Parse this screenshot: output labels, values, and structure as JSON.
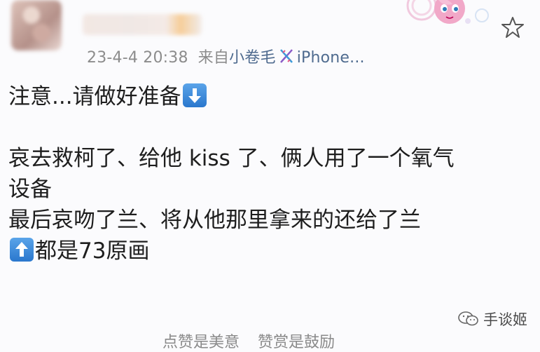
{
  "post": {
    "timestamp": "23-4-4 20:38",
    "source_prefix": "来自",
    "source_name": "小卷毛",
    "source_device": "iPhone...",
    "lines": [
      "注意...请做好准备",
      "哀去救柯了、给他 kiss 了、俩人用了一个氧气",
      "设备",
      "最后哀吻了兰、将从他那里拿来的还给了兰",
      "都是73原画"
    ]
  },
  "footer": {
    "like_text": "点赞是美意",
    "reward_text": "赞赏是鼓励"
  },
  "watermark": {
    "text": "手谈姬"
  },
  "icons": {
    "star": "star-icon",
    "dna": "dna-icon",
    "down_arrow": "down-arrow-emoji",
    "up_arrow": "up-arrow-emoji",
    "wechat": "wechat-icon"
  },
  "colors": {
    "meta_text": "#8c8c8c",
    "link": "#4f6b8f",
    "emoji_blue": "#3a8ad9"
  }
}
